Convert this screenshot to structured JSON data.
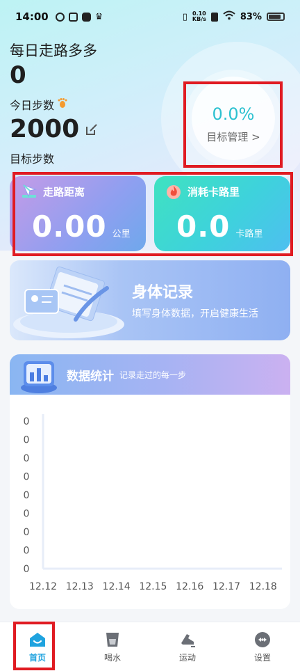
{
  "status_bar": {
    "time": "14:00",
    "speed_top": "0.10",
    "speed_bottom": "KB/s",
    "battery": "83%"
  },
  "header": {
    "title": "每日走路多多"
  },
  "today": {
    "steps_value": "0",
    "steps_label": "今日步数",
    "goal_value": "2000",
    "goal_label": "目标步数"
  },
  "goal_circle": {
    "percent": "0.0%",
    "manage_label": "目标管理 >"
  },
  "cards": {
    "walk": {
      "title": "走路距离",
      "value": "0.00",
      "unit": "公里"
    },
    "calories": {
      "title": "消耗卡路里",
      "value": "0.0",
      "unit": "卡路里"
    }
  },
  "body_banner": {
    "title": "身体记录",
    "subtitle": "填写身体数据，开启健康生活"
  },
  "stats": {
    "title": "数据统计",
    "subtitle": "记录走过的每一步"
  },
  "chart_data": {
    "type": "line",
    "categories": [
      "12.12",
      "12.13",
      "12.14",
      "12.15",
      "12.16",
      "12.17",
      "12.18"
    ],
    "y_ticks": [
      "0",
      "0",
      "0",
      "0",
      "0",
      "0",
      "0",
      "0",
      "0"
    ],
    "series": [
      {
        "values": [
          0,
          0,
          0,
          0,
          0,
          0,
          0
        ]
      }
    ],
    "grid": false
  },
  "tabs": [
    {
      "label": "首页",
      "icon": "home-icon",
      "active": true
    },
    {
      "label": "喝水",
      "icon": "cup-icon",
      "active": false
    },
    {
      "label": "运动",
      "icon": "shoe-icon",
      "active": false
    },
    {
      "label": "设置",
      "icon": "settings-icon",
      "active": false
    }
  ],
  "colors": {
    "accent": "#1fa3df",
    "teal": "#2cc1d0",
    "highlight": "#e01b22"
  }
}
